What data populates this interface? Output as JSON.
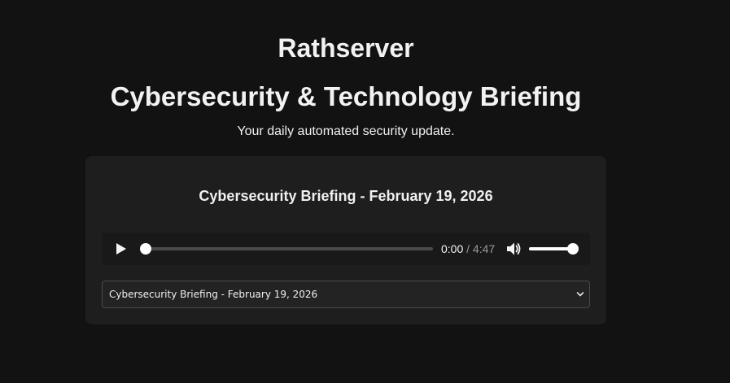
{
  "header": {
    "site_title": "Rathserver",
    "page_title": "Cybersecurity & Technology Briefing",
    "tagline": "Your daily automated security update."
  },
  "episode": {
    "title": "Cybersecurity Briefing - February 19, 2026"
  },
  "player": {
    "current_time": "0:00",
    "separator": " / ",
    "total_time": "4:47",
    "progress_fraction": 0,
    "volume_fraction": 1,
    "icons": {
      "play": "play-icon",
      "volume": "volume-icon"
    }
  },
  "episode_select": {
    "selected": "Cybersecurity Briefing - February 19, 2026",
    "icon": "chevron-down-icon"
  },
  "colors": {
    "background": "#121212",
    "card": "#1e1e1e",
    "player": "#191919",
    "track": "#4a4a4a",
    "accent": "#ffffff"
  }
}
